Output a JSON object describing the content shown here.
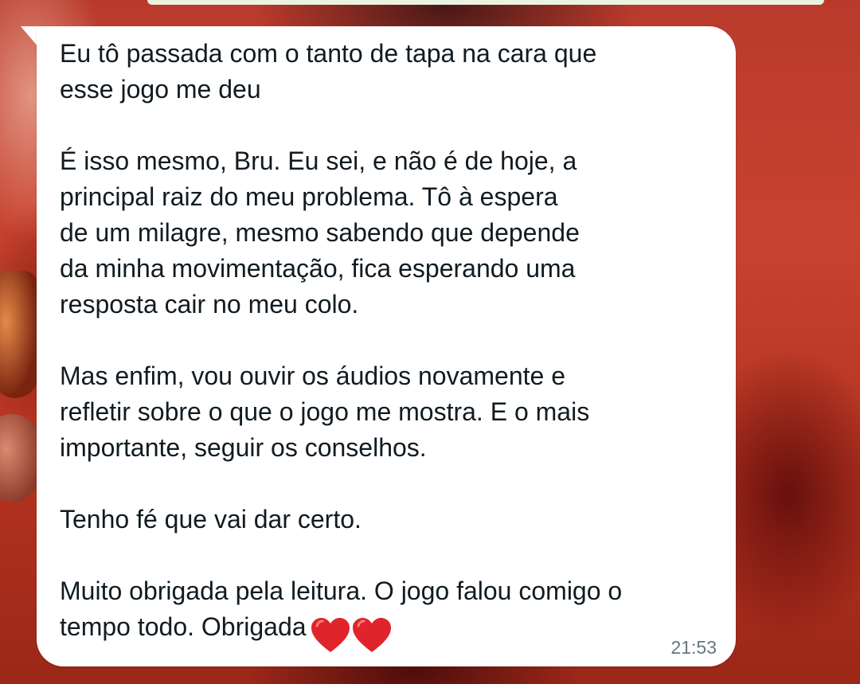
{
  "message": {
    "text": "Eu tô passada com o tanto de tapa na cara que\nesse jogo me deu\n\nÉ isso mesmo, Bru. Eu sei, e não é de hoje, a\nprincipal raiz do meu problema. Tô à espera\nde um milagre, mesmo sabendo que depende\nda minha movimentação, fica esperando uma\nresposta cair no meu colo.\n\nMas enfim, vou ouvir os áudios novamente e\nrefletir sobre o que o jogo me mostra. E o mais\nimportante, seguir os conselhos.\n\nTenho fé que vai dar certo.\n\nMuito obrigada pela leitura. O jogo falou comigo o\ntempo todo. Obrigada",
    "emoji": [
      "red-heart-icon",
      "red-heart-icon"
    ],
    "timestamp": "21:53"
  },
  "colors": {
    "bubble_background": "#ffffff",
    "text": "#111b21",
    "timestamp": "#667781",
    "wallpaper_accent": "#c8432f",
    "heart": "#e0242b"
  }
}
